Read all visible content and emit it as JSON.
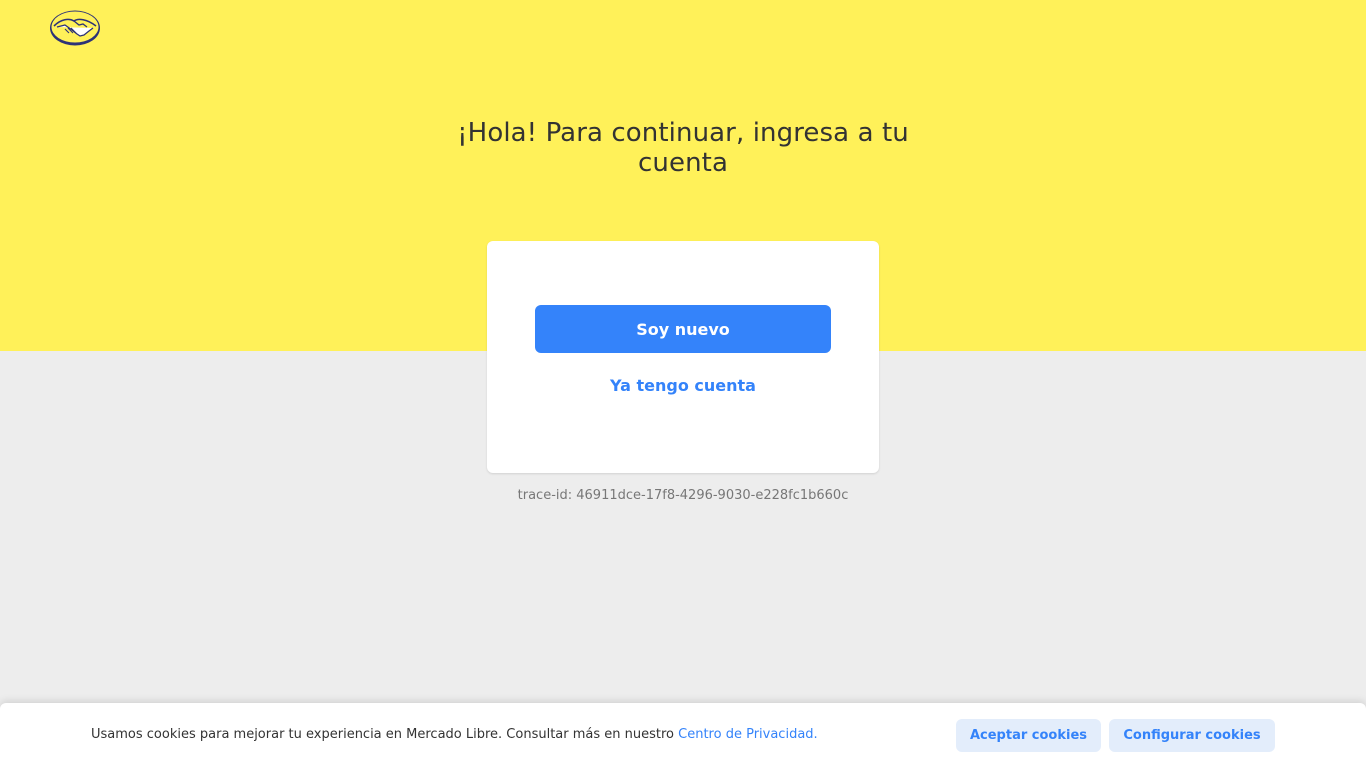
{
  "header": {
    "logo_icon": "mercado-libre-handshake-icon",
    "brand_color": "#fff159"
  },
  "main": {
    "title": "¡Hola! Para continuar, ingresa a tu cuenta",
    "primary_button": "Soy nuevo",
    "secondary_button": "Ya tengo cuenta",
    "trace_id": "trace-id: 46911dce-17f8-4296-9030-e228fc1b660c"
  },
  "cookies": {
    "message": "Usamos cookies para mejorar tu experiencia en Mercado Libre. Consultar más en nuestro ",
    "link_text": "Centro de Privacidad.",
    "accept_label": "Aceptar cookies",
    "configure_label": "Configurar cookies"
  },
  "colors": {
    "accent": "#3483fa",
    "background": "#ededed",
    "secondary_button_bg": "#e3edfb"
  }
}
